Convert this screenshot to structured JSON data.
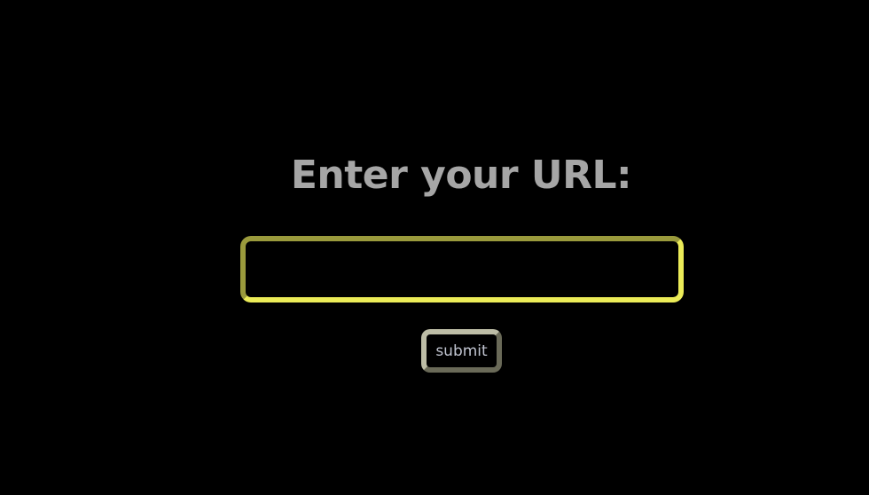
{
  "form": {
    "heading": "Enter your URL:",
    "url_input": {
      "value": "",
      "placeholder": ""
    },
    "submit_label": "submit"
  },
  "colors": {
    "background": "#000000",
    "heading_text": "#a6a6a6",
    "input_border_light": "#ecec58",
    "input_border_dark": "#9a9a3c",
    "button_border_light": "#bdbda6",
    "button_border_dark": "#6a6a58",
    "button_text": "#c0c4d0"
  }
}
